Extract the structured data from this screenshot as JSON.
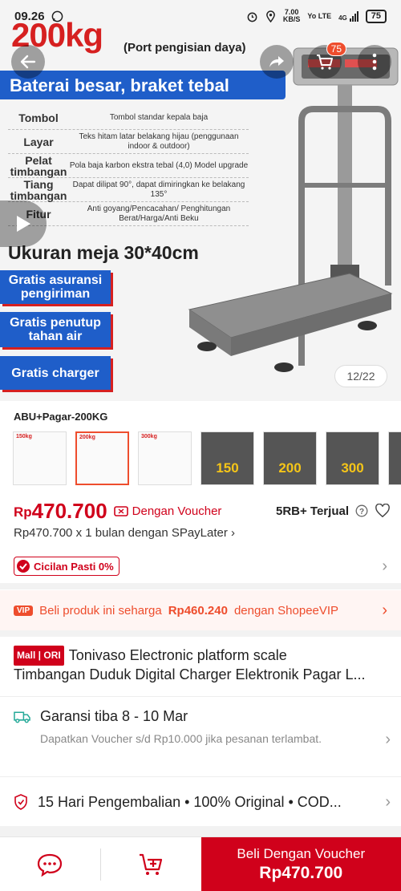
{
  "status_bar": {
    "time": "09.26",
    "net_speed_value": "7.00",
    "net_speed_unit": "KB/S",
    "volte": "Yo LTE",
    "network": "4G",
    "battery": "75"
  },
  "hero": {
    "title": "200kg",
    "subtitle": "(Port pengisian daya)",
    "banner": "Baterai besar, braket tebal",
    "specs": [
      {
        "key": "Tombol",
        "value": "Tombol standar kepala baja"
      },
      {
        "key": "Layar",
        "value": "Teks hitam latar belakang hijau (penggunaan indoor & outdoor)"
      },
      {
        "key": "Pelat timbangan",
        "value": "Pola baja karbon ekstra tebal (4,0) Model upgrade"
      },
      {
        "key": "Tiang timbangan",
        "value": "Dapat dilipat 90°, dapat dimiringkan ke belakang 135°"
      },
      {
        "key": "Fitur",
        "value": "Anti goyang/Pencacahan/ Penghitungan Berat/Harga/Anti Beku"
      }
    ],
    "size": "Ukuran meja 30*40cm",
    "perks": [
      "Gratis asuransi pengiriman",
      "Gratis penutup tahan air",
      "Gratis charger"
    ],
    "cart_count": "75",
    "counter": "12/22"
  },
  "variant": {
    "label": "ABU+Pagar-200KG",
    "thumbs": [
      {
        "label": "150kg",
        "num": ""
      },
      {
        "label": "200kg",
        "num": ""
      },
      {
        "label": "300kg",
        "num": ""
      },
      {
        "label": "",
        "num": "150"
      },
      {
        "label": "",
        "num": "200"
      },
      {
        "label": "",
        "num": "300"
      },
      {
        "label": "",
        "num": ""
      }
    ]
  },
  "price": {
    "currency": "Rp",
    "amount": "470.700",
    "voucher_label": "Dengan Voucher",
    "sold": "5RB+ Terjual",
    "paylater": "Rp470.700 x 1 bulan dengan SPayLater"
  },
  "cicilan": {
    "label": "Cicilan Pasti 0%"
  },
  "vip": {
    "icon": "VIP",
    "prefix": "Beli produk ini seharga",
    "price": "Rp460.240",
    "suffix": "dengan ShopeeVIP"
  },
  "product": {
    "mall_badge": "Mall | ORI",
    "title_line1": "Tonivaso Electronic platform scale",
    "title_line2": "Timbangan Duduk Digital Charger Elektronik Pagar L..."
  },
  "shipping": {
    "main": "Garansi tiba 8 - 10 Mar",
    "sub": "Dapatkan Voucher s/d Rp10.000 jika pesanan terlambat."
  },
  "returns": {
    "text": "15 Hari Pengembalian  •  100% Original  •  COD..."
  },
  "bottom_bar": {
    "buy_label": "Beli Dengan Voucher",
    "buy_price": "Rp470.700"
  },
  "colors": {
    "accent": "#ee4d2d",
    "price_red": "#d0011b",
    "banner_blue": "#1f5ec9"
  }
}
